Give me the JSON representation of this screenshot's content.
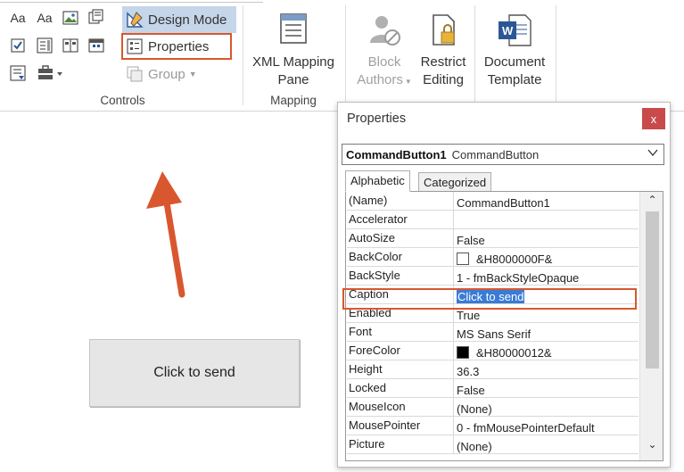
{
  "ribbon": {
    "controls": {
      "design_mode_label": "Design Mode",
      "properties_label": "Properties",
      "group_label": "Group",
      "group_caption": "Controls"
    },
    "mapping": {
      "xml_line1": "XML Mapping",
      "xml_line2": "Pane",
      "group_caption": "Mapping"
    },
    "protect": {
      "block_line1": "Block",
      "block_line2": "Authors",
      "restrict_line1": "Restrict",
      "restrict_line2": "Editing"
    },
    "templates": {
      "doc_line1": "Document",
      "doc_line2": "Template"
    }
  },
  "document": {
    "command_button_label": "Click to send"
  },
  "properties_window": {
    "title": "Properties",
    "close_glyph": "x",
    "object_name": "CommandButton1",
    "object_type": "CommandButton",
    "tabs": [
      "Alphabetic",
      "Categorized"
    ],
    "rows": [
      {
        "name": "(Name)",
        "value": "CommandButton1"
      },
      {
        "name": "Accelerator",
        "value": ""
      },
      {
        "name": "AutoSize",
        "value": "False"
      },
      {
        "name": "BackColor",
        "value": "&H8000000F&",
        "swatch": "#ffffff"
      },
      {
        "name": "BackStyle",
        "value": "1 - fmBackStyleOpaque"
      },
      {
        "name": "Caption",
        "value": "Click to send",
        "selected": true
      },
      {
        "name": "Enabled",
        "value": "True"
      },
      {
        "name": "Font",
        "value": "MS Sans Serif"
      },
      {
        "name": "ForeColor",
        "value": "&H80000012&",
        "swatch": "#000000"
      },
      {
        "name": "Height",
        "value": "36.3"
      },
      {
        "name": "Locked",
        "value": "False"
      },
      {
        "name": "MouseIcon",
        "value": "(None)"
      },
      {
        "name": "MousePointer",
        "value": "0 - fmMousePointerDefault"
      },
      {
        "name": "Picture",
        "value": "(None)"
      }
    ]
  },
  "colors": {
    "highlight_border": "#d9572f",
    "design_mode_bg": "#c5d5ea",
    "close_button_bg": "#c94a4a",
    "arrow": "#d9572f",
    "selection": "#3a7bd5"
  }
}
